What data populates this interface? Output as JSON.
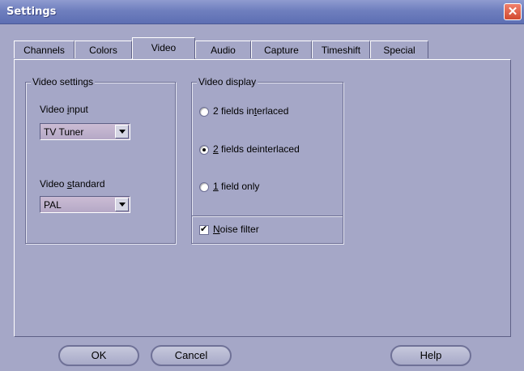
{
  "window": {
    "title": "Settings",
    "close_glyph": "✕"
  },
  "tabs": [
    {
      "label": "Channels",
      "active": false
    },
    {
      "label": "Colors",
      "active": false
    },
    {
      "label": "Video",
      "active": true
    },
    {
      "label": "Audio",
      "active": false
    },
    {
      "label": "Capture",
      "active": false
    },
    {
      "label": "Timeshift",
      "active": false
    },
    {
      "label": "Special",
      "active": false
    }
  ],
  "video_settings": {
    "group_label": "Video settings",
    "input_label_pre": "Video ",
    "input_label_u": "i",
    "input_label_post": "nput",
    "input_value": "TV Tuner",
    "standard_label_pre": "Video ",
    "standard_label_u": "s",
    "standard_label_post": "tandard",
    "standard_value": "PAL"
  },
  "video_display": {
    "group_label": "Video display",
    "options": [
      {
        "pre": "2 fields in",
        "u": "t",
        "post": "erlaced",
        "checked": false
      },
      {
        "pre": "",
        "u": "2",
        "post": " fields deinterlaced",
        "checked": true
      },
      {
        "pre": "",
        "u": "1",
        "post": " field only",
        "checked": false
      }
    ],
    "noise_filter": {
      "pre": "",
      "u": "N",
      "post": "oise filter",
      "checked": true
    }
  },
  "buttons": {
    "ok": "OK",
    "cancel": "Cancel",
    "help": "Help"
  }
}
